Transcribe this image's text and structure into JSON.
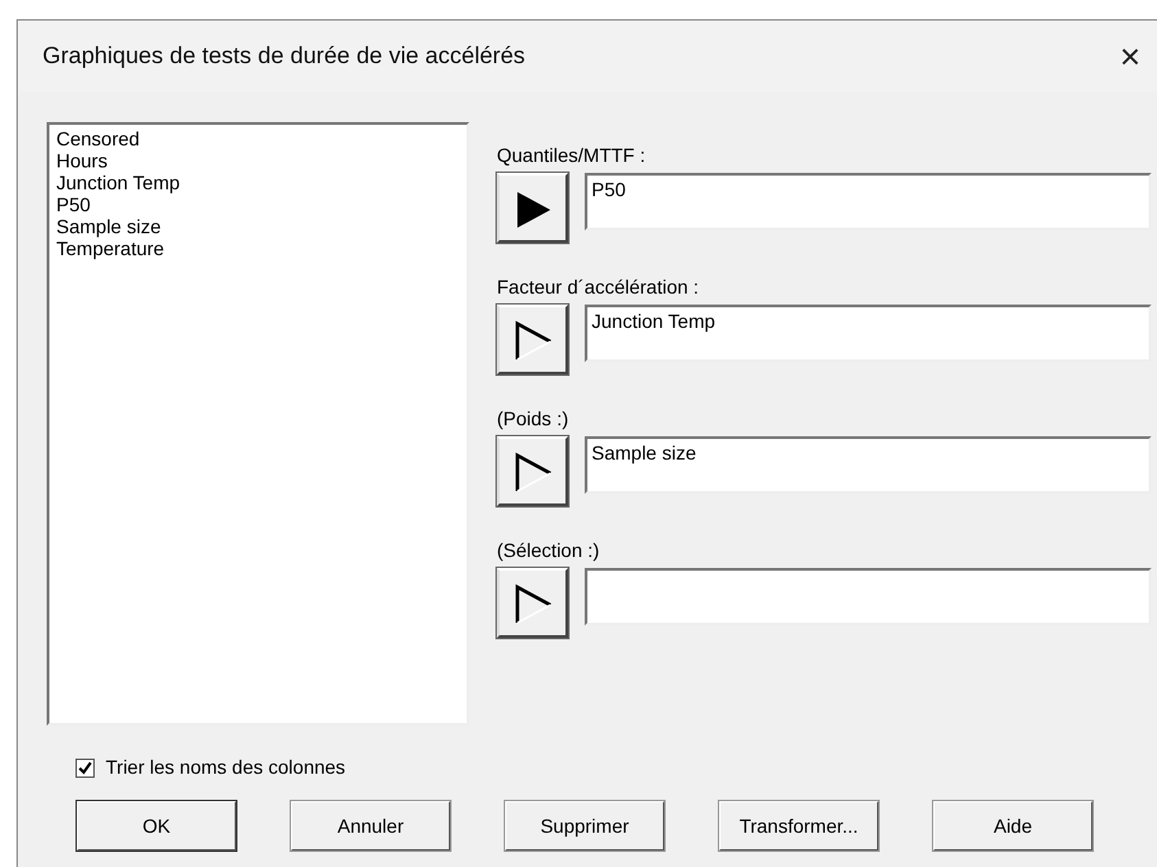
{
  "window": {
    "title": "Graphiques de tests de durée de vie accélérés",
    "close": "×"
  },
  "columns": [
    "Censored",
    "Hours",
    "Junction Temp",
    "P50",
    "Sample size",
    "Temperature"
  ],
  "fields": [
    {
      "label": "Quantiles/MTTF :",
      "value": "P50",
      "active": true
    },
    {
      "label": "Facteur d´accélération :",
      "value": "Junction Temp",
      "active": false
    },
    {
      "label": "(Poids :)",
      "value": "Sample size",
      "active": false
    },
    {
      "label": "(Sélection :)",
      "active": false
    }
  ],
  "sort_checkbox": {
    "label": "Trier les noms des colonnes",
    "checked": true
  },
  "buttons": [
    "OK",
    "Annuler",
    "Supprimer",
    "Transformer...",
    "Aide"
  ]
}
